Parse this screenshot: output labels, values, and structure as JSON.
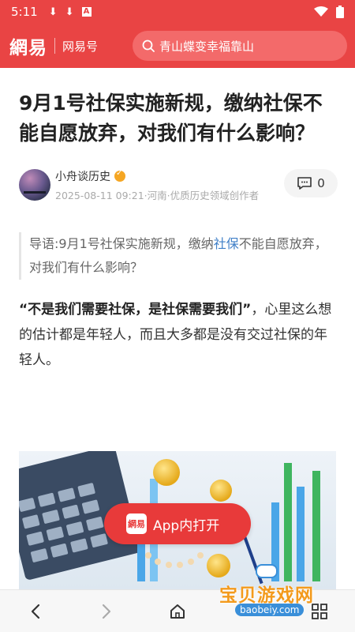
{
  "status_bar": {
    "time": "5:11",
    "icons": [
      "download-icon",
      "download-icon",
      "text-a-icon",
      "wifi-icon",
      "battery-icon"
    ]
  },
  "header": {
    "logo": "網易",
    "channel": "网易号",
    "search": {
      "value": "青山蝶变幸福靠山"
    }
  },
  "article": {
    "title": "9月1号社保实施新规，缴纳社保不能自愿放弃，对我们有什么影响？",
    "author": {
      "name": "小舟谈历史",
      "meta": "2025-08-11 09:21·河南·优质历史领域创作者"
    },
    "comments": {
      "count": "0"
    },
    "lead": {
      "prefix": "导语:9月1号社保实施新规，缴纳",
      "link": "社保",
      "suffix": "不能自愿放弃，对我们有什么影响？"
    },
    "para": {
      "bold": "“不是我们需要社保，是社保需要我们”",
      "text": "，心里这么想的估计都是年轻人，而且大多都是没有交过社保的年轻人。"
    }
  },
  "app_float": {
    "logo": "網易",
    "label": "App内打开"
  },
  "watermark": {
    "text": "宝贝游戏网",
    "url": "baobeiy.com"
  },
  "colors": {
    "brand": "#e94444",
    "link": "#3f7fc7"
  }
}
